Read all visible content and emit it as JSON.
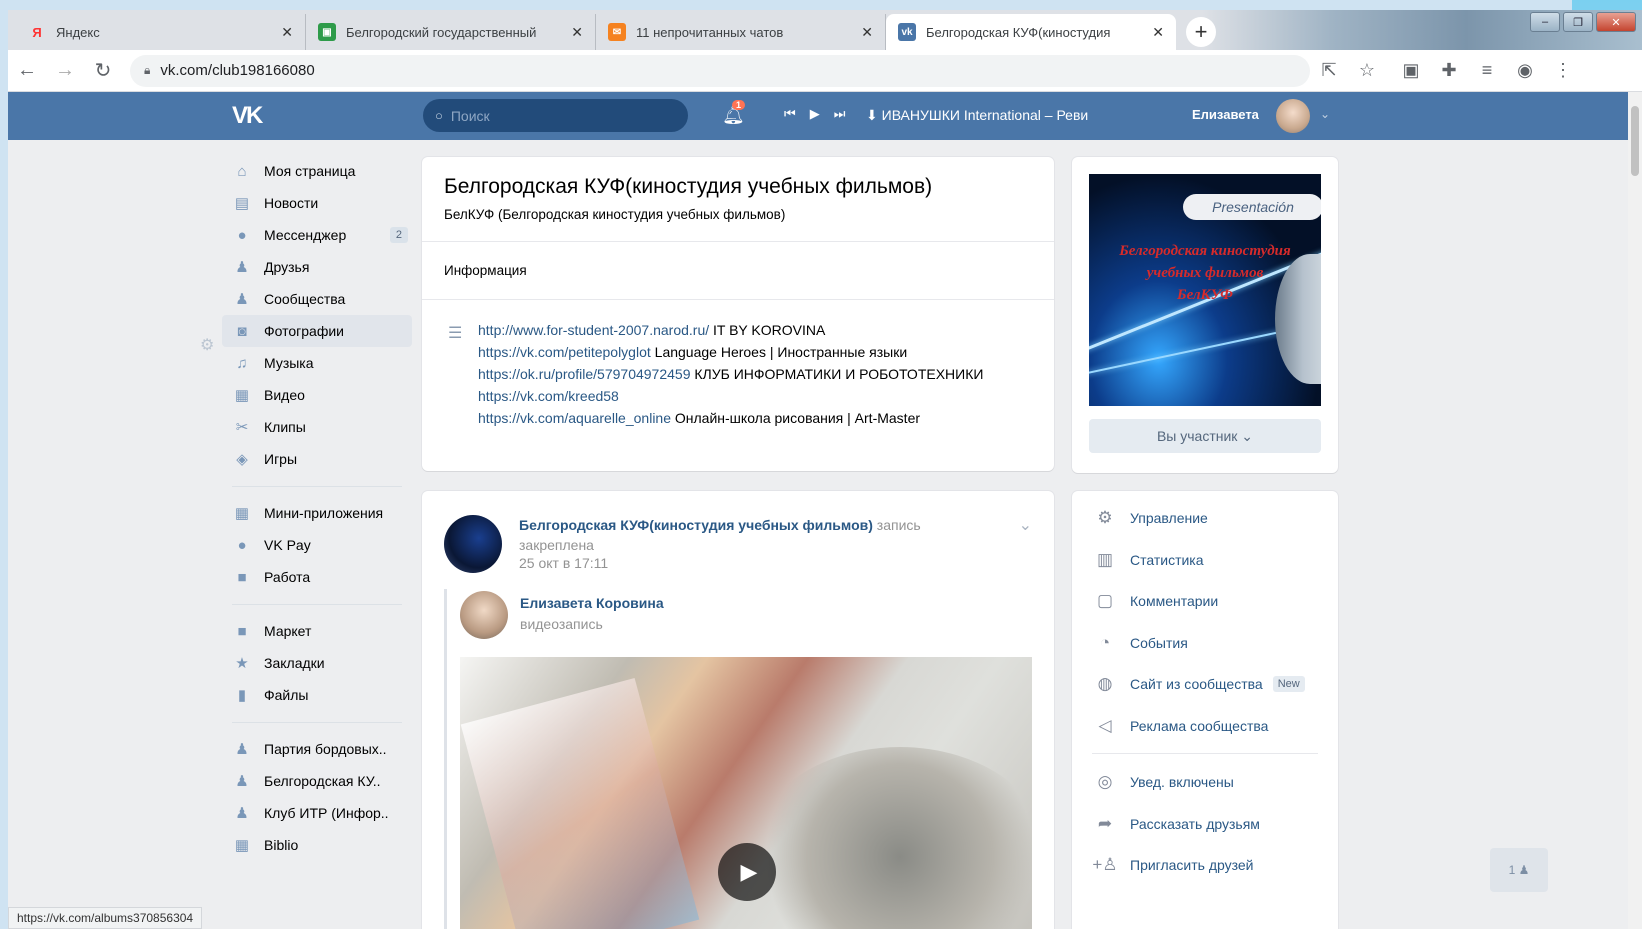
{
  "browser": {
    "tabs": [
      {
        "icon": "yandex-icon",
        "title": "Яндекс",
        "active": false
      },
      {
        "icon": "school-icon",
        "title": "Белгородский государственный",
        "active": false
      },
      {
        "icon": "mail-icon",
        "title": "11 непрочитанных чатов",
        "active": false
      },
      {
        "icon": "vk-icon",
        "title": "Белгородская КУФ(киностудия",
        "active": true
      }
    ],
    "new_tab": "+",
    "url": "vk.com/club198166080",
    "status_url": "https://vk.com/albums370856304"
  },
  "header": {
    "logo": "VK",
    "search_placeholder": "Поиск",
    "notifications_count": "1",
    "track": "ИВАНУШКИ International – Реви",
    "user_name": "Елизавета"
  },
  "left_menu": {
    "groups": [
      [
        {
          "icon": "home-icon",
          "glyph": "⌂",
          "label": "Моя страница"
        },
        {
          "icon": "news-icon",
          "glyph": "▤",
          "label": "Новости"
        },
        {
          "icon": "messenger-icon",
          "glyph": "●",
          "label": "Мессенджер",
          "count": "2"
        },
        {
          "icon": "friends-icon",
          "glyph": "♟",
          "label": "Друзья"
        },
        {
          "icon": "communities-icon",
          "glyph": "♟",
          "label": "Сообщества"
        },
        {
          "icon": "photos-icon",
          "glyph": "◙",
          "label": "Фотографии",
          "selected": true
        },
        {
          "icon": "music-icon",
          "glyph": "♫",
          "label": "Музыка"
        },
        {
          "icon": "video-icon",
          "glyph": "▦",
          "label": "Видео"
        },
        {
          "icon": "clips-icon",
          "glyph": "✂",
          "label": "Клипы"
        },
        {
          "icon": "games-icon",
          "glyph": "◈",
          "label": "Игры"
        }
      ],
      [
        {
          "icon": "apps-icon",
          "glyph": "▦",
          "label": "Мини-приложения"
        },
        {
          "icon": "vkpay-icon",
          "glyph": "●",
          "label": "VK Pay"
        },
        {
          "icon": "work-icon",
          "glyph": "■",
          "label": "Работа"
        }
      ],
      [
        {
          "icon": "market-icon",
          "glyph": "■",
          "label": "Маркет"
        },
        {
          "icon": "bookmarks-icon",
          "glyph": "★",
          "label": "Закладки"
        },
        {
          "icon": "files-icon",
          "glyph": "▮",
          "label": "Файлы"
        }
      ],
      [
        {
          "icon": "group-icon",
          "glyph": "♟",
          "label": "Партия бордовых.."
        },
        {
          "icon": "group-icon",
          "glyph": "♟",
          "label": "Белгородская КУ.."
        },
        {
          "icon": "group-icon",
          "glyph": "♟",
          "label": "Клуб ИТР (Инфор.."
        },
        {
          "icon": "app-icon",
          "glyph": "▦",
          "label": "Biblio"
        }
      ]
    ]
  },
  "group": {
    "title": "Белгородская КУФ(киностудия учебных фильмов)",
    "subtitle": "БелКУФ (Белгородская киностудия учебных фильмов)",
    "info_label": "Информация",
    "links": [
      {
        "url": "http://www.for-student-2007.narod.ru/",
        "text": " IT BY KOROVINA"
      },
      {
        "url": "https://vk.com/petitepolyglot",
        "text": " Language Heroes | Иностранные языки"
      },
      {
        "url": "https://ok.ru/profile/579704972459",
        "text": " КЛУБ ИНФОРМАТИКИ И РОБОТОТЕХНИКИ"
      },
      {
        "url": "https://vk.com/kreed58",
        "text": ""
      },
      {
        "url": "https://vk.com/aquarelle_online",
        "text": " Онлайн-школа рисования | Art-Master"
      }
    ]
  },
  "post": {
    "author": "Белгородская КУФ(киностудия учебных фильмов)",
    "pinned_note": " запись закреплена",
    "date": "25 окт в 17:11",
    "repost_author": "Елизавета Коровина",
    "repost_type": "видеозапись"
  },
  "cover": {
    "badge": "Presentación",
    "text_lines": [
      "Белгородская киностудия",
      "учебных фильмов",
      "БелКУФ"
    ],
    "member_button": "Вы участник ⌄"
  },
  "right_menu": {
    "items": [
      {
        "icon": "gear-icon",
        "glyph": "⚙",
        "label": "Управление"
      },
      {
        "icon": "stats-icon",
        "glyph": "▥",
        "label": "Статистика"
      },
      {
        "icon": "comments-icon",
        "glyph": "▢",
        "label": "Комментарии"
      },
      {
        "icon": "events-icon",
        "glyph": "◔",
        "label": "События"
      },
      {
        "icon": "globe-icon",
        "glyph": "◍",
        "label": "Сайт из сообщества",
        "badge": "New"
      },
      {
        "icon": "megaphone-icon",
        "glyph": "◁",
        "label": "Реклама сообщества"
      }
    ],
    "items2": [
      {
        "icon": "bell-icon",
        "glyph": "◎",
        "label": "Увед. включены"
      },
      {
        "icon": "share-icon",
        "glyph": "➦",
        "label": "Рассказать друзьям"
      },
      {
        "icon": "invite-icon",
        "glyph": "+♙",
        "label": "Пригласить друзей"
      }
    ]
  },
  "online_badge": "1 ♟",
  "colors": {
    "vk_blue": "#4a76a8",
    "link": "#2a5885",
    "bg": "#edeef0"
  }
}
